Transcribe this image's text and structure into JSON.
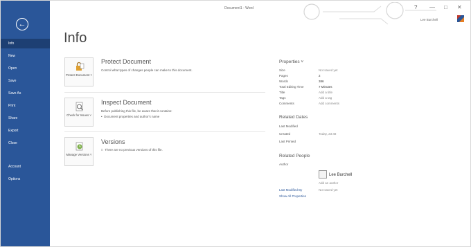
{
  "window": {
    "title": "Document1 - Word",
    "user_name": "Lee Burchell",
    "controls": {
      "help": "?",
      "minimize": "—",
      "restore": "□",
      "close": "✕"
    }
  },
  "sidebar": {
    "back_icon": "←",
    "items": [
      {
        "label": "Info"
      },
      {
        "label": "New"
      },
      {
        "label": "Open"
      },
      {
        "label": "Save"
      },
      {
        "label": "Save As"
      },
      {
        "label": "Print"
      },
      {
        "label": "Share"
      },
      {
        "label": "Export"
      },
      {
        "label": "Close"
      },
      {
        "label": "Account"
      },
      {
        "label": "Options"
      }
    ]
  },
  "page": {
    "title": "Info"
  },
  "sections": {
    "protect": {
      "button_label": "Protect Document",
      "button_arrow": "˅",
      "title": "Protect Document",
      "description": "Control what types of changes people can make to this document."
    },
    "inspect": {
      "button_label": "Check for Issues",
      "button_arrow": "˅",
      "title": "Inspect Document",
      "description": "Before publishing this file, be aware that it contains:",
      "bullet": "Document properties and author's name"
    },
    "versions": {
      "button_label": "Manage Versions",
      "button_arrow": "˅",
      "title": "Versions",
      "description": "There are no previous versions of this file."
    }
  },
  "properties": {
    "header": "Properties ˅",
    "rows": [
      {
        "label": "Size",
        "value": "Not saved yet"
      },
      {
        "label": "Pages",
        "value": "2"
      },
      {
        "label": "Words",
        "value": "386"
      },
      {
        "label": "Total Editing Time",
        "value": "7 Minutes"
      },
      {
        "label": "Title",
        "value": "Add a title"
      },
      {
        "label": "Tags",
        "value": "Add a tag"
      },
      {
        "label": "Comments",
        "value": "Add comments"
      }
    ],
    "related_dates": {
      "header": "Related Dates",
      "rows": [
        {
          "label": "Last Modified",
          "value": ""
        },
        {
          "label": "Created",
          "value": "Today, 23:48"
        },
        {
          "label": "Last Printed",
          "value": ""
        }
      ]
    },
    "related_people": {
      "header": "Related People",
      "author_label": "Author",
      "author_name": "Lee Burchell",
      "add_author": "Add an author",
      "last_modified_by_label": "Last Modified By",
      "last_modified_by_value": "Not saved yet",
      "show_all": "Show All Properties"
    }
  }
}
